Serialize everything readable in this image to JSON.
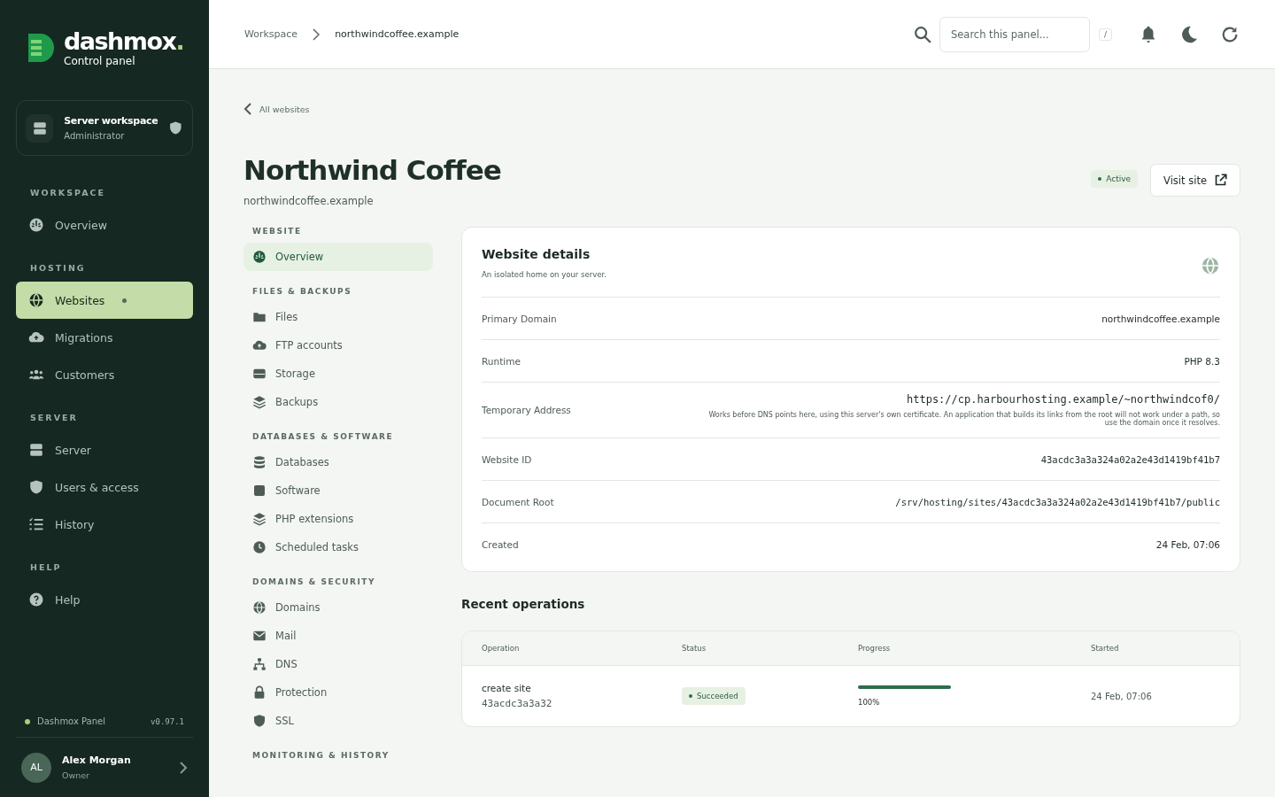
{
  "brand": {
    "name": "dashmox",
    "suffix": ".",
    "tagline": "Control panel"
  },
  "workspace": {
    "title": "Server workspace",
    "role": "Administrator"
  },
  "sidebar": {
    "sections": [
      {
        "title": "WORKSPACE",
        "items": [
          {
            "label": "Overview",
            "selected": false,
            "dot": false
          }
        ]
      },
      {
        "title": "HOSTING",
        "items": [
          {
            "label": "Websites",
            "selected": true,
            "dot": true
          },
          {
            "label": "Migrations",
            "selected": false,
            "dot": false
          },
          {
            "label": "Customers",
            "selected": false,
            "dot": false
          }
        ]
      },
      {
        "title": "SERVER",
        "items": [
          {
            "label": "Server",
            "selected": false,
            "dot": false
          },
          {
            "label": "Users & access",
            "selected": false,
            "dot": false
          },
          {
            "label": "History",
            "selected": false,
            "dot": false
          }
        ]
      },
      {
        "title": "HELP",
        "items": [
          {
            "label": "Help",
            "selected": false,
            "dot": false
          }
        ]
      }
    ]
  },
  "status": {
    "label": "Dashmox Panel",
    "version": "v0.97.1",
    "color": "#a6d17a"
  },
  "user": {
    "initials": "AL",
    "name": "Alex Morgan",
    "role": "Owner"
  },
  "breadcrumb": [
    {
      "label": "Workspace",
      "current": false
    },
    {
      "label": "northwindcoffee.example",
      "current": true
    }
  ],
  "search": {
    "placeholder": "Search this panel...",
    "shortcut": "/"
  },
  "back_link": "All websites",
  "page": {
    "title": "Northwind Coffee",
    "subtitle": "northwindcoffee.example",
    "status": "Active",
    "visit": "Visit site"
  },
  "subnav": {
    "sections": [
      {
        "title": "WEBSITE",
        "items": [
          {
            "label": "Overview",
            "selected": true
          }
        ]
      },
      {
        "title": "FILES & BACKUPS",
        "items": [
          {
            "label": "Files",
            "selected": false
          },
          {
            "label": "FTP accounts",
            "selected": false
          },
          {
            "label": "Storage",
            "selected": false
          },
          {
            "label": "Backups",
            "selected": false
          }
        ]
      },
      {
        "title": "DATABASES & SOFTWARE",
        "items": [
          {
            "label": "Databases",
            "selected": false
          },
          {
            "label": "Software",
            "selected": false
          },
          {
            "label": "PHP extensions",
            "selected": false
          },
          {
            "label": "Scheduled tasks",
            "selected": false
          }
        ]
      },
      {
        "title": "DOMAINS & SECURITY",
        "items": [
          {
            "label": "Domains",
            "selected": false
          },
          {
            "label": "Mail",
            "selected": false
          },
          {
            "label": "DNS",
            "selected": false
          },
          {
            "label": "Protection",
            "selected": false
          },
          {
            "label": "SSL",
            "selected": false
          }
        ]
      },
      {
        "title": "MONITORING & HISTORY"
      }
    ]
  },
  "details": {
    "title": "Website details",
    "subtitle": "An isolated home on your server.",
    "rows": [
      {
        "label": "Primary Domain",
        "value": "northwindcoffee.example",
        "kind": "text"
      },
      {
        "label": "Runtime",
        "value": "PHP 8.3",
        "kind": "text"
      },
      {
        "label": "Temporary Address",
        "value": "https://cp.harbourhosting.example/~northwindcof0/",
        "kind": "link",
        "note": "Works before DNS points here, using this server's own certificate. An application that builds its links from the root will not work under a path, so use the domain once it resolves."
      },
      {
        "label": "Website ID",
        "value": "43acdc3a3a324a02a2e43d1419bf41b7",
        "kind": "mono"
      },
      {
        "label": "Document Root",
        "value": "/srv/hosting/sites/43acdc3a3a324a02a2e43d1419bf41b7/public",
        "kind": "mono"
      },
      {
        "label": "Created",
        "value": "24 Feb, 07:06",
        "kind": "text"
      }
    ]
  },
  "operations": {
    "title": "Recent operations",
    "columns": [
      "Operation",
      "Status",
      "Progress",
      "Started"
    ],
    "rows": [
      {
        "operation": "create site",
        "id": "43acdc3a3a32",
        "status": "Succeeded",
        "level": 1,
        "progress": "100%",
        "started": "24 Feb, 07:06"
      }
    ]
  }
}
